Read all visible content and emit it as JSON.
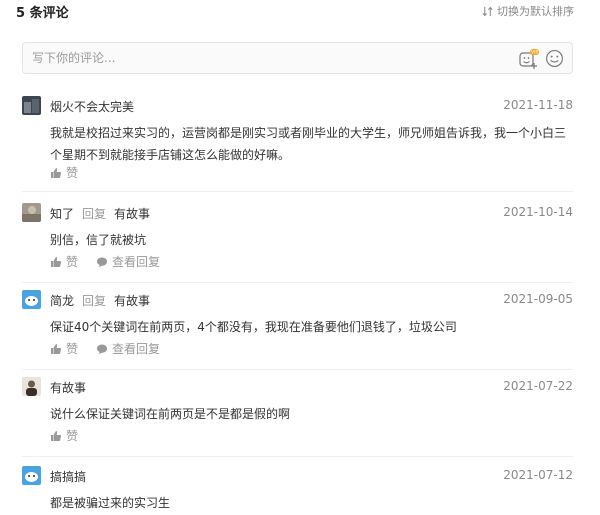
{
  "header": {
    "count_label": "5 条评论",
    "sort_label": "切换为默认排序"
  },
  "input": {
    "placeholder": "写下你的评论..."
  },
  "comments": [
    {
      "user": "烟火不会太完美",
      "date": "2021-11-18",
      "content": "我就是校招过来实习的，运营岗都是刚实习或者刚毕业的大学生，师兄师姐告诉我，我一个小白三个星期不到就能接手店铺这怎么能做的好嘛。",
      "like_label": "赞"
    },
    {
      "user": "知了",
      "reply_label": "回复",
      "reply_to": "有故事",
      "date": "2021-10-14",
      "content": "别信，信了就被坑",
      "like_label": "赞",
      "view_replies_label": "查看回复"
    },
    {
      "user": "简龙",
      "reply_label": "回复",
      "reply_to": "有故事",
      "date": "2021-09-05",
      "content": "保证40个关键词在前两页，4个都没有，我现在准备要他们退钱了，垃圾公司",
      "like_label": "赞",
      "view_replies_label": "查看回复"
    },
    {
      "user": "有故事",
      "date": "2021-07-22",
      "content": "说什么保证关键词在前两页是不是都是假的啊",
      "like_label": "赞"
    },
    {
      "user": "搞搞搞",
      "date": "2021-07-12",
      "content": "都是被骗过来的实习生"
    }
  ],
  "colors": {
    "text": "#333333",
    "muted": "#999999",
    "date": "#8a8a8a",
    "divider": "#efefef",
    "vip_badge": "#f5a623"
  }
}
